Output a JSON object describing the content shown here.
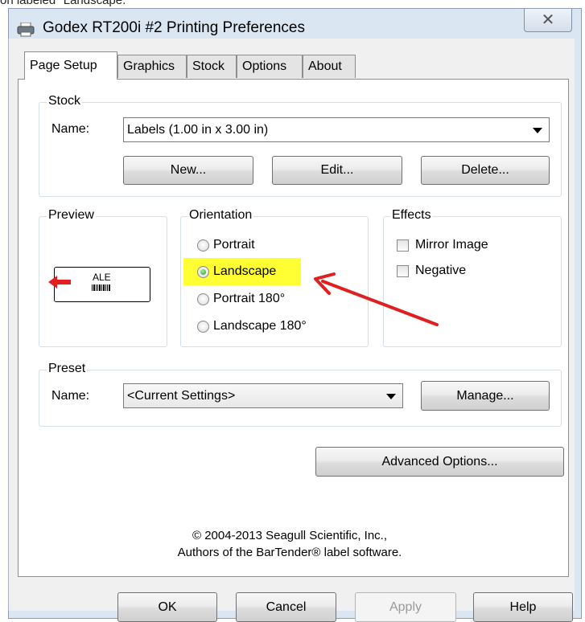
{
  "caption": "on labeled \"Landscape.\"",
  "window": {
    "title": "Godex RT200i #2 Printing Preferences",
    "close_glyph": "✕"
  },
  "tabs": [
    {
      "label": "Page Setup"
    },
    {
      "label": "Graphics"
    },
    {
      "label": "Stock"
    },
    {
      "label": "Options"
    },
    {
      "label": "About"
    }
  ],
  "stock": {
    "group_label": "Stock",
    "name_label": "Name:",
    "name_value": "Labels (1.00 in x 3.00 in)",
    "new_label": "New...",
    "edit_label": "Edit...",
    "delete_label": "Delete..."
  },
  "preview": {
    "group_label": "Preview",
    "label_text": "ALE"
  },
  "orientation": {
    "group_label": "Orientation",
    "options": [
      "Portrait",
      "Landscape",
      "Portrait 180°",
      "Landscape 180°"
    ],
    "selected": "Landscape"
  },
  "effects": {
    "group_label": "Effects",
    "mirror_label": "Mirror Image",
    "negative_label": "Negative"
  },
  "preset": {
    "group_label": "Preset",
    "name_label": "Name:",
    "name_value": "<Current Settings>",
    "manage_label": "Manage..."
  },
  "advanced_label": "Advanced Options...",
  "copyright": {
    "line1": "© 2004-2013 Seagull Scientific, Inc.,",
    "line2": "Authors of the BarTender® label software."
  },
  "footer": {
    "ok": "OK",
    "cancel": "Cancel",
    "apply": "Apply",
    "help": "Help"
  },
  "colors": {
    "highlight": "#ffff33",
    "annotation_arrow": "#e02020",
    "radio_selected": "#2aa52a"
  }
}
